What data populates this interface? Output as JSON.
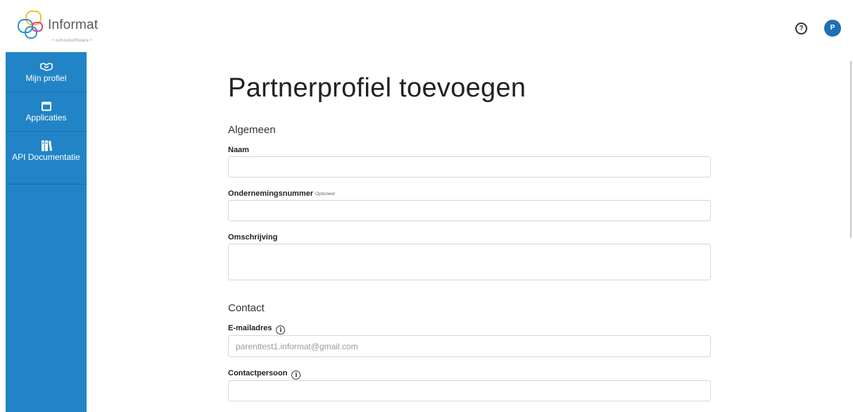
{
  "header": {
    "logo_text": "Informat",
    "logo_subtext": "• schoolsoftware •",
    "help_icon": "question-circle-icon",
    "help_glyph": "?",
    "avatar_initial": "P"
  },
  "sidebar": {
    "items": [
      {
        "label": "Mijn profiel",
        "icon": "handshake-icon"
      },
      {
        "label": "Applicaties",
        "icon": "window-icon"
      },
      {
        "label": "API Documentatie",
        "icon": "books-icon"
      }
    ]
  },
  "page": {
    "title": "Partnerprofiel toevoegen",
    "sections": {
      "general": "Algemeen",
      "contact": "Contact"
    },
    "fields": {
      "naam": {
        "label": "Naam",
        "value": ""
      },
      "ondernemingsnummer": {
        "label": "Ondernemingsnummer",
        "optional": "Optioneel",
        "value": ""
      },
      "omschrijving": {
        "label": "Omschrijving",
        "value": ""
      },
      "email": {
        "label": "E-mailadres",
        "placeholder": "parenttest1.informat@gmail.com",
        "value": ""
      },
      "contactpersoon": {
        "label": "Contactpersoon",
        "value": ""
      }
    },
    "info_glyph": "i"
  },
  "colors": {
    "sidebar": "#2184c6",
    "avatar": "#1f6fb3",
    "logo_yellow": "#f4c22b",
    "logo_blue": "#2a8fd0",
    "logo_pink": "#e0418a"
  }
}
